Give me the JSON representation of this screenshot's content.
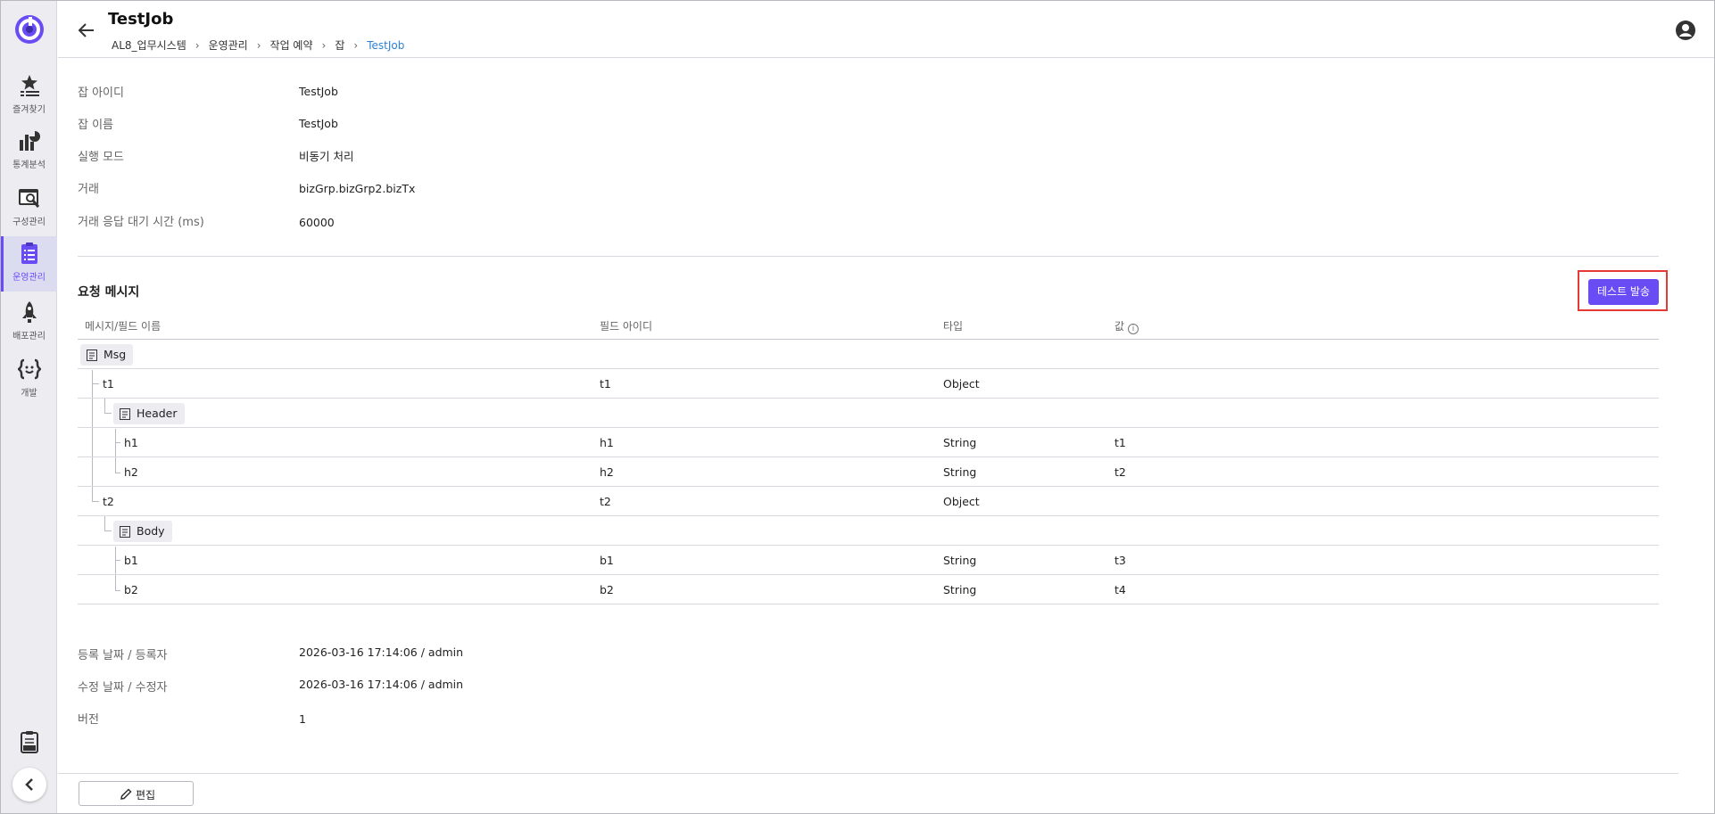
{
  "sidebar": {
    "items": [
      {
        "label": "즐겨찾기",
        "icon": "star-list-icon"
      },
      {
        "label": "통계분석",
        "icon": "chart-icon"
      },
      {
        "label": "구성관리",
        "icon": "config-search-icon"
      },
      {
        "label": "운영관리",
        "icon": "clipboard-icon"
      },
      {
        "label": "배포관리",
        "icon": "rocket-icon"
      },
      {
        "label": "개발",
        "icon": "code-braces-icon"
      }
    ],
    "active_index": 3
  },
  "header": {
    "title": "TestJob",
    "breadcrumb": [
      "AL8_업무시스템",
      "운영관리",
      "작업 예약",
      "잡",
      "TestJob"
    ]
  },
  "info": [
    {
      "label": "잡 아이디",
      "value": "TestJob"
    },
    {
      "label": "잡 이름",
      "value": "TestJob"
    },
    {
      "label": "실행 모드",
      "value": "비동기 처리"
    },
    {
      "label": "거래",
      "value": "bizGrp.bizGrp2.bizTx"
    },
    {
      "label": "거래 응답 대기 시간 (ms)",
      "value": "60000"
    }
  ],
  "request": {
    "title": "요청 메시지",
    "test_button": "테스트 발송",
    "columns": [
      "메시지/필드 이름",
      "필드 아이디",
      "타입",
      "값"
    ],
    "rows": [
      {
        "name": "Msg",
        "field_id": "",
        "type": "",
        "value": "",
        "kind": "message",
        "depth": 0
      },
      {
        "name": "t1",
        "field_id": "t1",
        "type": "Object",
        "value": "",
        "kind": "field",
        "depth": 1
      },
      {
        "name": "Header",
        "field_id": "",
        "type": "",
        "value": "",
        "kind": "message",
        "depth": 2
      },
      {
        "name": "h1",
        "field_id": "h1",
        "type": "String",
        "value": "t1",
        "kind": "field",
        "depth": 3
      },
      {
        "name": "h2",
        "field_id": "h2",
        "type": "String",
        "value": "t2",
        "kind": "field",
        "depth": 3
      },
      {
        "name": "t2",
        "field_id": "t2",
        "type": "Object",
        "value": "",
        "kind": "field",
        "depth": 1
      },
      {
        "name": "Body",
        "field_id": "",
        "type": "",
        "value": "",
        "kind": "message",
        "depth": 2
      },
      {
        "name": "b1",
        "field_id": "b1",
        "type": "String",
        "value": "t3",
        "kind": "field",
        "depth": 3
      },
      {
        "name": "b2",
        "field_id": "b2",
        "type": "String",
        "value": "t4",
        "kind": "field",
        "depth": 3
      }
    ]
  },
  "meta": [
    {
      "label": "등록 날짜 / 등록자",
      "value": "2026-03-16 17:14:06 / admin"
    },
    {
      "label": "수정 날짜 / 수정자",
      "value": "2026-03-16 17:14:06 / admin"
    },
    {
      "label": "버전",
      "value": "1"
    }
  ],
  "footer": {
    "edit_button": "편집"
  },
  "colors": {
    "accent": "#6a4cf5",
    "link": "#2f80d6",
    "highlight": "#e53935"
  }
}
